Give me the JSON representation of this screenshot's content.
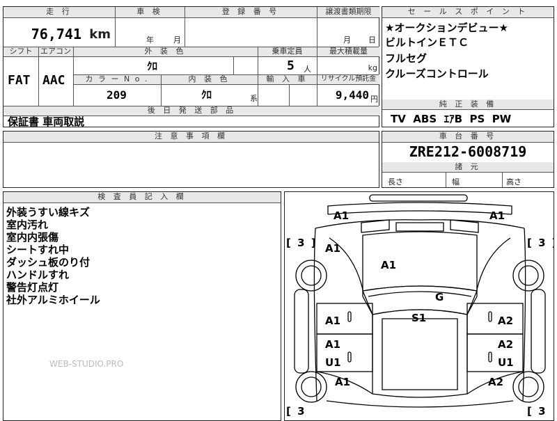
{
  "top": {
    "h_mileage": "走 行",
    "mileage": "76,741",
    "mileage_unit": "km",
    "h_inspection": "車 検",
    "insp_year": "年",
    "insp_month": "月",
    "h_registration": "登 録 番 号",
    "h_transfer": "譲渡書類期限",
    "tr_month": "月",
    "tr_day": "日",
    "h_shift": "シフト",
    "shift": "FAT",
    "h_aircon": "エアコン",
    "aircon": "AAC",
    "h_exterior": "外 装 色",
    "exterior": "ｸﾛ",
    "h_seats": "乗車定員",
    "seats": "5",
    "seats_unit": "人",
    "h_load": "最大積載量",
    "load_unit": "kg",
    "h_color_no": "カ ラ ー N o .",
    "color_no": "209",
    "h_interior": "内 装 色",
    "interior": "ｸﾛ",
    "interior_suffix": "系",
    "h_import": "輸 入 車",
    "h_recycle": "リサイクル預託金",
    "recycle": "9,440",
    "recycle_unit": "円",
    "h_later_parts": "後 日 発 送 部 品",
    "later_parts": "保証書 車両取説"
  },
  "sales": {
    "header": "セ ー ル ス ポ イ ン ト",
    "lines": [
      "★オークションデビュー★",
      "ビルトインＥＴＣ",
      "フルセグ",
      "クルーズコントロール"
    ],
    "equip_header": "純 正 装 備",
    "equip": "TV  ABS  ｴｱB  PS  PW"
  },
  "notes": {
    "header": "注 意 事 項 欄"
  },
  "chassis": {
    "header": "車 台 番 号",
    "number": "ZRE212-6008719",
    "dims_header": "諸 元",
    "length": "長さ",
    "width": "幅",
    "height": "高さ"
  },
  "inspector": {
    "header": "検 査 員 記 入 欄",
    "lines": [
      "外装うすい線キズ",
      "室内汚れ",
      "室内内張傷",
      "シートすれ中",
      "ダッシュ板のり付",
      "ハンドルすれ",
      "警告灯点灯",
      "社外アルミホイール"
    ]
  },
  "watermark": "WEB-STUDIO.PRO",
  "diagram": {
    "marks": {
      "front_left": "A1",
      "front_right": "A1",
      "fender_fl": "A1",
      "hood": "A1",
      "windshield": "G",
      "roof": "S1",
      "door_fl": "A1",
      "door_rl": "A1",
      "door_rl2": "U1",
      "door_fr": "A2",
      "door_rr": "A2",
      "door_rr2": "U1",
      "quarter_l": "A1",
      "quarter_r": "A2"
    },
    "tires": {
      "fl": "[ 3 ]",
      "fr": "[ 3 ]",
      "rl": "[ 3",
      "rr": "[ 3"
    }
  }
}
